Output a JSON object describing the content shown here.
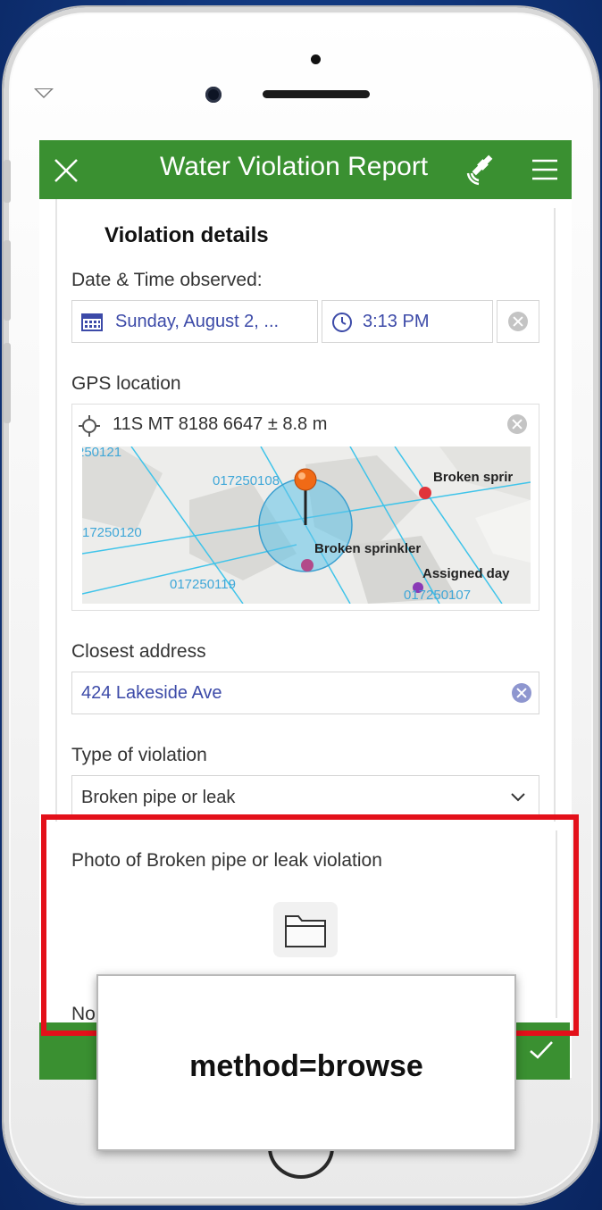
{
  "header": {
    "title": "Water Violation Report"
  },
  "form": {
    "group_title": "Violation details",
    "date_time": {
      "label": "Date & Time observed:",
      "date_value": "Sunday, August 2, ...",
      "time_value": "3:13 PM"
    },
    "gps": {
      "label": "GPS location",
      "coordinates": "11S MT 8188 6647 ± 8.8 m",
      "map_labels": {
        "parcel_1": "250121",
        "parcel_2": "017250108",
        "parcel_3": "17250120",
        "parcel_4": "017250119",
        "parcel_5": "017250107",
        "feature_1": "Broken sprir",
        "feature_2": "Broken sprinkler",
        "feature_3": "Assigned day"
      }
    },
    "address": {
      "label": "Closest address",
      "value": "424 Lakeside Ave"
    },
    "violation_type": {
      "label": "Type of violation",
      "value": "Broken pipe or leak"
    },
    "photo": {
      "label": "Photo of Broken pipe or leak violation"
    },
    "notes_partial": "No"
  },
  "overlay": {
    "caption": "method=browse"
  },
  "colors": {
    "header_green": "#3a9031",
    "link_blue": "#3c4aa8",
    "highlight_red": "#e3101a"
  }
}
